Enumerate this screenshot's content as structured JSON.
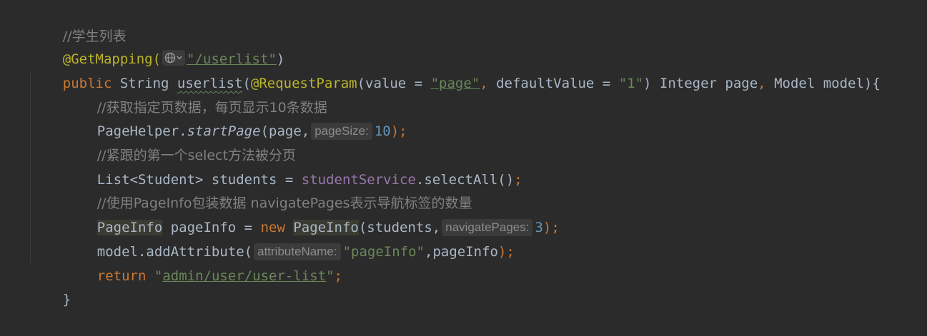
{
  "code": {
    "l1_comment": "//学生列表",
    "l2_annotation": "@GetMapping(",
    "l2_path": "\"/userlist\"",
    "l2_close": ")",
    "l3_public": "public",
    "l3_string": " String ",
    "l3_method": "userlist",
    "l3_open": "(",
    "l3_reqparam": "@RequestParam",
    "l3_args1": "(value = ",
    "l3_page_str": "\"page\"",
    "l3_comma1": ", ",
    "l3_default": "defaultValue = ",
    "l3_one_str": "\"1\"",
    "l3_args2": ") Integer page",
    "l3_comma2": ", ",
    "l3_args3": "Model model){",
    "l4_comment": "//获取指定页数据，每页显示10条数据",
    "l5_a": "PageHelper.",
    "l5_startpage": "startPage",
    "l5_b": "(page,",
    "l5_hint": "pageSize:",
    "l5_num": "10",
    "l5_end": ");",
    "l6_comment": "//紧跟的第一个select方法被分页",
    "l7_a": "List<Student> students = ",
    "l7_field": "studentService",
    "l7_b": ".selectAll()",
    "l7_end": ";",
    "l8_comment": "//使用PageInfo包装数据 navigatePages表示导航标签的数量",
    "l9_type": "PageInfo",
    "l9_a": " pageInfo = ",
    "l9_new": "new",
    "l9_space": " ",
    "l9_type2": "PageInfo",
    "l9_b": "(students,",
    "l9_hint": "navigatePages:",
    "l9_num": "3",
    "l9_end": ");",
    "l10_a": "model.addAttribute(",
    "l10_hint": "attributeName:",
    "l10_str": "\"pageInfo\"",
    "l10_b": ",pageInfo",
    "l10_end": ");",
    "l11_return": "return",
    "l11_space": " ",
    "l11_q1": "\"",
    "l11_path": "admin/user/user-list",
    "l11_q2": "\"",
    "l11_end": ";",
    "l12_brace": "}"
  },
  "icons": {
    "globe": "globe-icon",
    "chevron": "chevron-down-icon"
  }
}
